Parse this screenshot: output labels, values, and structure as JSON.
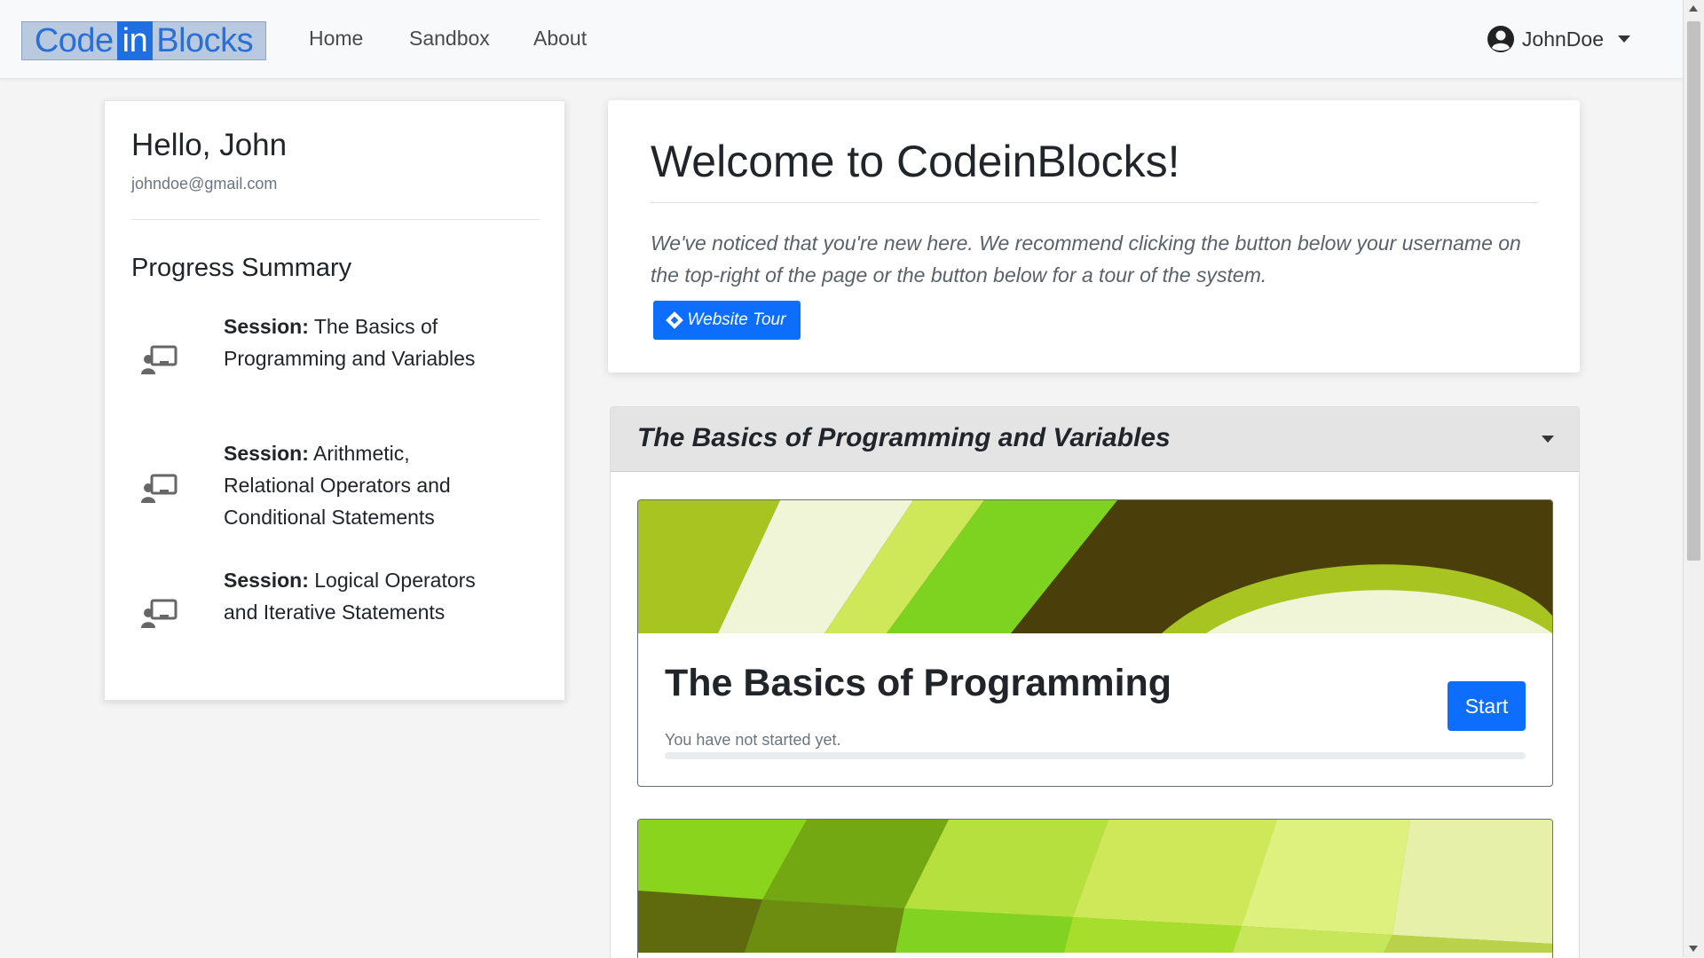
{
  "nav": {
    "logo_left": "Code",
    "logo_mid": "in",
    "logo_right": "Blocks",
    "links": [
      "Home",
      "Sandbox",
      "About"
    ],
    "username": "JohnDoe",
    "user_icon": "user-circle-icon"
  },
  "profile": {
    "greeting": "Hello, John",
    "email": "johndoe@gmail.com",
    "progress_title": "Progress Summary",
    "session_prefix": "Session:",
    "sessions": [
      {
        "name": "The Basics of Programming and Variables",
        "icon": "chalkboard-teacher-icon"
      },
      {
        "name": "Arithmetic, Relational Operators and Conditional Statements",
        "icon": "chalkboard-teacher-icon"
      },
      {
        "name": "Logical Operators and Iterative Statements",
        "icon": "chalkboard-teacher-icon"
      }
    ]
  },
  "welcome": {
    "title": "Welcome to CodeinBlocks!",
    "text": "We've noticed that you're new here. We recommend clicking the button below your username on the top-right of the page or the button below for a tour of the system.",
    "tour_button": "Website Tour",
    "tour_icon": "map-signs-icon"
  },
  "accordion": {
    "title": "The Basics of Programming and Variables",
    "lessons": [
      {
        "title": "The Basics of Programming",
        "status": "You have not started yet.",
        "button": "Start",
        "progress": 0
      }
    ]
  },
  "colors": {
    "primary": "#0d6efd",
    "banner_dark": "#4a3f0a",
    "banner_lime": "#7ed321",
    "banner_cream": "#f1f5d8"
  }
}
